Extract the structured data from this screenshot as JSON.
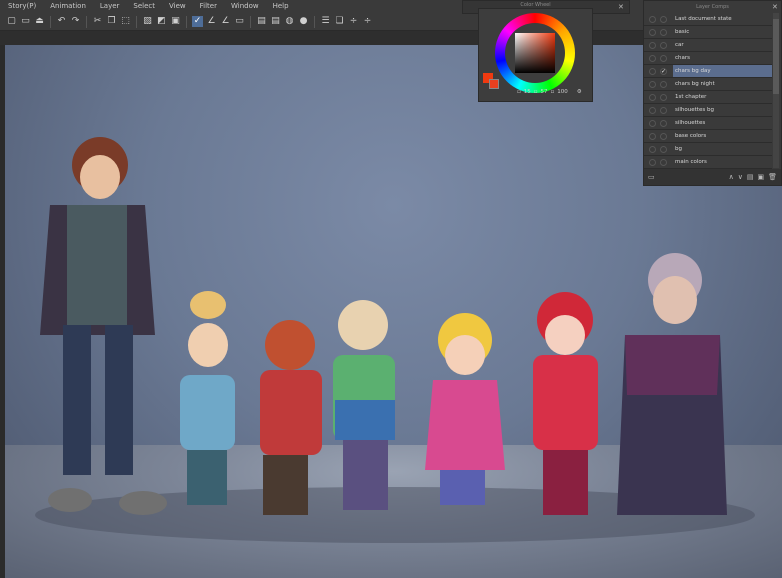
{
  "menu": [
    "Story(P)",
    "Animation",
    "Layer",
    "Select",
    "View",
    "Filter",
    "Window",
    "Help"
  ],
  "toolbar_icons": [
    "new-icon",
    "open-icon",
    "save-icon",
    "undo-icon",
    "redo-icon",
    "cut-icon",
    "copy-icon",
    "transform-icon",
    "clear-icon",
    "fill-icon",
    "select-icon",
    "check-icon",
    "pen-icon",
    "ruler-icon",
    "layer-icon",
    "folder-icon",
    "folder2-icon",
    "color-icon",
    "palette-icon",
    "list-icon",
    "copy2-icon",
    "flip-v-icon",
    "flip-h-icon"
  ],
  "color_wheel": {
    "title": "Color Wheel",
    "h": "15",
    "s": "57",
    "v": "100",
    "main_color": "#f03a10",
    "sub_color": "#e84020"
  },
  "layer_comps": {
    "title": "Layer Comps",
    "selected": "chars bg day",
    "items": [
      "Last document state",
      "basic",
      "car",
      "chars",
      "chars bg day",
      "chars bg night",
      "1st chapter",
      "silhouettes bg",
      "silhouettes",
      "base colors",
      "bg",
      "main colors"
    ]
  },
  "colors": {
    "canvas": "#6a7994",
    "selection": "#5b6d8e"
  }
}
